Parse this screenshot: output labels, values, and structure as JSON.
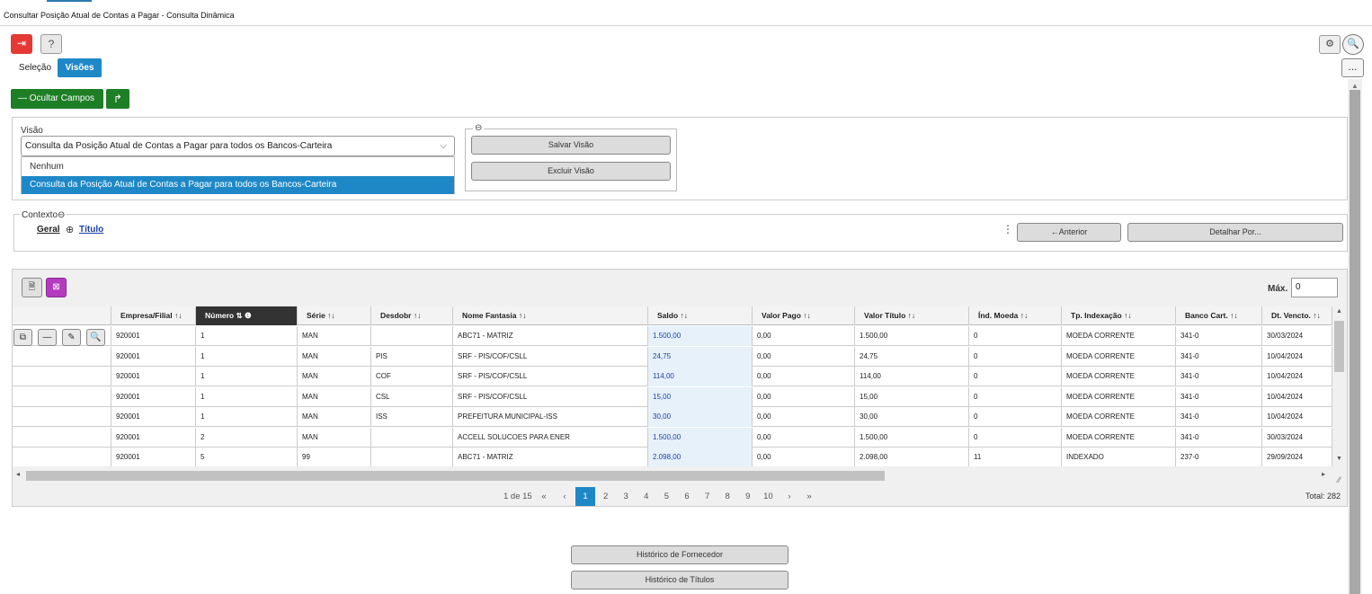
{
  "window": {
    "title": "Consultar Posição Atual de Contas a Pagar - Consulta Dinâmica"
  },
  "toolbar": {
    "exit_icon": "⇥",
    "help_label": "?",
    "gear_icon": "⚙",
    "search_icon": "🔍",
    "more_icon": "..."
  },
  "tabs": [
    {
      "label": "Seleção"
    },
    {
      "label": "Visões"
    }
  ],
  "actions": {
    "ocultar_label": "— Ocultar Campos",
    "share_icon": "↱"
  },
  "visao": {
    "label": "Visão",
    "selected": "Consulta da Posição Atual de Contas a Pagar para todos os Bancos-Carteira",
    "options": [
      "Nenhum",
      "Consulta da Posição Atual de Contas a Pagar para todos os Bancos-Carteira"
    ],
    "salvar_label": "Salvar Visão",
    "excluir_label": "Excluir Visão",
    "collapse_icon": "⊖"
  },
  "contexto": {
    "label": "Contexto",
    "collapse_icon": "⊖",
    "geral": "Geral",
    "arrow_icon": "⊕",
    "titulo": "Título",
    "anterior_label": "←Anterior",
    "detalhar_label": "Detalhar Por...",
    "kebab_icon": "⋮"
  },
  "grid": {
    "max_label": "Máx.",
    "max_value": "0",
    "columns": [
      {
        "label": ""
      },
      {
        "label": "Empresa/Filial ↑↓"
      },
      {
        "label": "Número ⇅ ❶"
      },
      {
        "label": "Série ↑↓"
      },
      {
        "label": "Desdobr ↑↓"
      },
      {
        "label": "Nome Fantasia ↑↓"
      },
      {
        "label": "Saldo ↑↓"
      },
      {
        "label": "Valor Pago ↑↓"
      },
      {
        "label": "Valor Título ↑↓"
      },
      {
        "label": "Índ. Moeda ↑↓"
      },
      {
        "label": "Tp. Indexação ↑↓"
      },
      {
        "label": "Banco Cart. ↑↓"
      },
      {
        "label": "Dt. Vencto. ↑↓"
      }
    ],
    "rows": [
      {
        "empresa": "920001",
        "numero": "1",
        "serie": "MAN",
        "desdobr": "",
        "nome": "ABC71 - MATRIZ",
        "saldo": "1.500,00",
        "valor_pago": "0,00",
        "valor_titulo": "1.500,00",
        "ind_moeda": "0",
        "tp_index": "MOEDA CORRENTE",
        "banco": "341-0",
        "dt_vencto": "30/03/2024"
      },
      {
        "empresa": "920001",
        "numero": "1",
        "serie": "MAN",
        "desdobr": "PIS",
        "nome": "SRF - PIS/COF/CSLL",
        "saldo": "24,75",
        "valor_pago": "0,00",
        "valor_titulo": "24,75",
        "ind_moeda": "0",
        "tp_index": "MOEDA CORRENTE",
        "banco": "341-0",
        "dt_vencto": "10/04/2024"
      },
      {
        "empresa": "920001",
        "numero": "1",
        "serie": "MAN",
        "desdobr": "COF",
        "nome": "SRF - PIS/COF/CSLL",
        "saldo": "114,00",
        "valor_pago": "0,00",
        "valor_titulo": "114,00",
        "ind_moeda": "0",
        "tp_index": "MOEDA CORRENTE",
        "banco": "341-0",
        "dt_vencto": "10/04/2024"
      },
      {
        "empresa": "920001",
        "numero": "1",
        "serie": "MAN",
        "desdobr": "CSL",
        "nome": "SRF - PIS/COF/CSLL",
        "saldo": "15,00",
        "valor_pago": "0,00",
        "valor_titulo": "15,00",
        "ind_moeda": "0",
        "tp_index": "MOEDA CORRENTE",
        "banco": "341-0",
        "dt_vencto": "10/04/2024"
      },
      {
        "empresa": "920001",
        "numero": "1",
        "serie": "MAN",
        "desdobr": "ISS",
        "nome": "PREFEITURA MUNICIPAL-ISS",
        "saldo": "30,00",
        "valor_pago": "0,00",
        "valor_titulo": "30,00",
        "ind_moeda": "0",
        "tp_index": "MOEDA CORRENTE",
        "banco": "341-0",
        "dt_vencto": "10/04/2024"
      },
      {
        "empresa": "920001",
        "numero": "2",
        "serie": "MAN",
        "desdobr": "",
        "nome": "ACCELL SOLUCOES PARA ENER",
        "saldo": "1.500,00",
        "valor_pago": "0,00",
        "valor_titulo": "1.500,00",
        "ind_moeda": "0",
        "tp_index": "MOEDA CORRENTE",
        "banco": "341-0",
        "dt_vencto": "30/03/2024"
      },
      {
        "empresa": "920001",
        "numero": "5",
        "serie": "99",
        "desdobr": "",
        "nome": "ABC71 - MATRIZ",
        "saldo": "2.098,00",
        "valor_pago": "0,00",
        "valor_titulo": "2.098,00",
        "ind_moeda": "11",
        "tp_index": "INDEXADO",
        "banco": "237-0",
        "dt_vencto": "29/09/2024"
      }
    ],
    "row_tools": [
      "⧉",
      "—",
      "✎",
      "🔍"
    ]
  },
  "pagination": {
    "info": "1 de 15",
    "first": "«",
    "prev": "‹",
    "pages": [
      "1",
      "2",
      "3",
      "4",
      "5",
      "6",
      "7",
      "8",
      "9",
      "10"
    ],
    "current": "1",
    "next": "›",
    "last": "»",
    "total": "Total: 282"
  },
  "footer": {
    "historico_fornecedor": "Histórico de Fornecedor",
    "historico_titulos": "Histórico de Títulos"
  },
  "colors": {
    "accent": "#1e88c7",
    "green": "#1e7e25",
    "red": "#e53935",
    "purple": "#b43bbf"
  }
}
